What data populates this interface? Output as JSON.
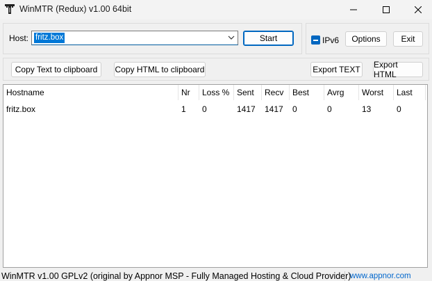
{
  "window": {
    "title": "WinMTR (Redux) v1.00 64bit",
    "icons": {
      "app": "winmtr-app-icon",
      "minimize": "minimize-icon",
      "maximize": "maximize-icon",
      "close": "close-icon"
    }
  },
  "host": {
    "label": "Host:",
    "value": "fritz.box",
    "dropdown_icon": "chevron-down-icon",
    "start_label": "Start"
  },
  "options": {
    "ipv6_label": "IPv6",
    "ipv6_state": "indeterminate",
    "options_label": "Options",
    "exit_label": "Exit"
  },
  "toolbar": {
    "copy_text_label": "Copy Text to clipboard",
    "copy_html_label": "Copy HTML to clipboard",
    "export_text_label": "Export TEXT",
    "export_html_label": "Export HTML"
  },
  "table": {
    "columns": [
      "Hostname",
      "Nr",
      "Loss %",
      "Sent",
      "Recv",
      "Best",
      "Avrg",
      "Worst",
      "Last"
    ],
    "rows": [
      [
        "fritz.box",
        "1",
        "0",
        "1417",
        "1417",
        "0",
        "0",
        "13",
        "0"
      ]
    ]
  },
  "status": {
    "text": "WinMTR v1.00 GPLv2 (original by Appnor MSP - Fully Managed Hosting & Cloud Provider)",
    "link": "www.appnor.com"
  },
  "colors": {
    "accent": "#0067c0",
    "selection": "#0078d7",
    "link": "#0066cc"
  }
}
